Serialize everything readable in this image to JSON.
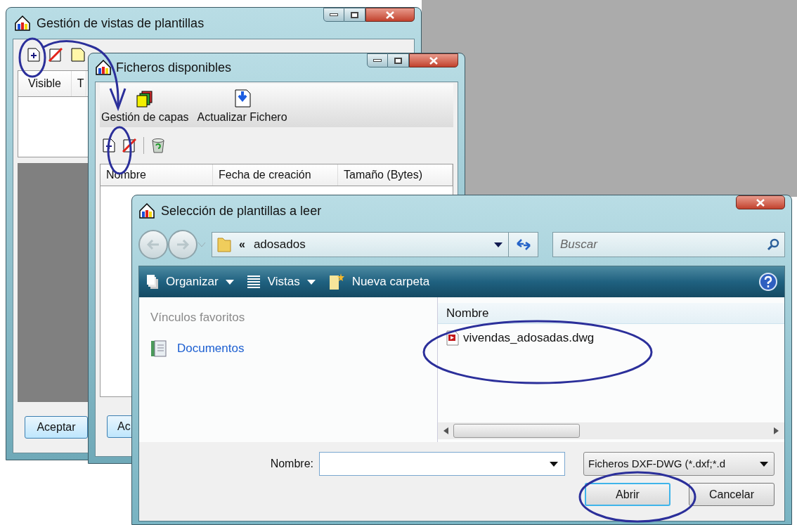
{
  "main_window": {
    "title": "Gestión de vistas de plantillas",
    "columns": [
      "Visible",
      "T"
    ],
    "buttons": [
      "Aceptar"
    ]
  },
  "files_window": {
    "title": "Ficheros disponibles",
    "toolbar": [
      "Gestión de capas",
      "Actualizar Fichero"
    ],
    "columns": [
      "Nombre",
      "Fecha de creación",
      "Tamaño (Bytes)"
    ],
    "buttons": [
      "Ac"
    ]
  },
  "open_dialog": {
    "title": "Selección de plantillas a leer",
    "path_prefix": "«",
    "path": "adosados",
    "search": {
      "placeholder": "Buscar"
    },
    "commands": [
      {
        "label": "Organizar",
        "kind": "menu"
      },
      {
        "label": "Vistas",
        "kind": "menu"
      },
      {
        "label": "Nueva carpeta",
        "kind": "action"
      }
    ],
    "favorites_heading": "Vínculos favoritos",
    "favorites": [
      "Documentos"
    ],
    "column": "Nombre",
    "files": [
      {
        "name": "vivendas_adosadas.dwg",
        "selected": false
      }
    ],
    "filename_label": "Nombre:",
    "filter": "Ficheros DXF-DWG (*.dxf;*.d",
    "buttons": [
      {
        "label": "Abrir",
        "default": true
      },
      {
        "label": "Cancelar",
        "default": false
      }
    ]
  }
}
